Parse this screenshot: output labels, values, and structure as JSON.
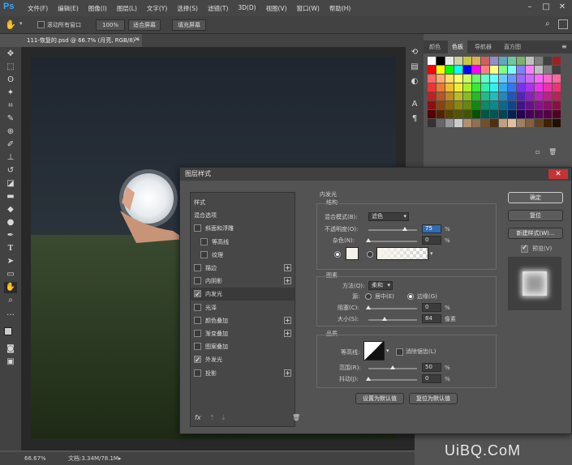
{
  "app": {
    "logo": "Ps"
  },
  "menu": [
    "文件(F)",
    "编辑(E)",
    "图像(I)",
    "图层(L)",
    "文字(Y)",
    "选择(S)",
    "滤镜(T)",
    "3D(D)",
    "视图(V)",
    "窗口(W)",
    "帮助(H)"
  ],
  "options_bar": {
    "scroll_all_label": "滚动所有窗口",
    "zoom_value": "100%",
    "fit_screen": "适合屏幕",
    "fill_screen": "填充屏幕"
  },
  "document": {
    "tab_label": "111-恢复的.psd @ 66.7% (月亮, RGB/8) *",
    "zoom": "66.67%",
    "doc_size": "文档:3.34M/78.1M"
  },
  "panels": {
    "tabs": [
      "颜色",
      "色板",
      "导航器",
      "直方图"
    ],
    "active_tab": "色板"
  },
  "swatches": {
    "rows": [
      [
        "#ffffff",
        "#000000",
        "#e8e8e8",
        "#d0d0a0",
        "#c8c840",
        "#e0b050",
        "#d06060",
        "#9090c8",
        "#60a8c0",
        "#70c8a0",
        "#80b070",
        "#c0c0c0",
        "#808080",
        "#404040",
        "#a02020"
      ],
      [
        "#ff0000",
        "#ffff00",
        "#00ff00",
        "#00ffff",
        "#0000ff",
        "#ff00ff",
        "#ff8080",
        "#ffff80",
        "#80ff80",
        "#80ffff",
        "#8080ff",
        "#ff80ff",
        "#c0c0c0",
        "#808080",
        "#404040"
      ],
      [
        "#ff6666",
        "#ffaa66",
        "#ffdd66",
        "#ffff66",
        "#ccff66",
        "#66ff66",
        "#66ffcc",
        "#66ffff",
        "#66ccff",
        "#6699ff",
        "#9966ff",
        "#cc66ff",
        "#ff66ff",
        "#ff66cc",
        "#ff6699"
      ],
      [
        "#ee3333",
        "#ee7733",
        "#eebb33",
        "#eeee33",
        "#aaee33",
        "#33ee33",
        "#33eeaa",
        "#33eeee",
        "#33aaee",
        "#3377ee",
        "#7733ee",
        "#aa33ee",
        "#ee33ee",
        "#ee33aa",
        "#ee3377"
      ],
      [
        "#bb2222",
        "#bb5522",
        "#bb8822",
        "#bbbb22",
        "#88bb22",
        "#22bb22",
        "#22bb88",
        "#22bbbb",
        "#2288bb",
        "#2255bb",
        "#5522bb",
        "#8822bb",
        "#bb22bb",
        "#bb2288",
        "#bb2255"
      ],
      [
        "#881111",
        "#884411",
        "#886611",
        "#888811",
        "#668811",
        "#118811",
        "#118866",
        "#118888",
        "#116688",
        "#114488",
        "#441188",
        "#661188",
        "#881188",
        "#881166",
        "#881144"
      ],
      [
        "#550000",
        "#552200",
        "#554400",
        "#555500",
        "#445500",
        "#005500",
        "#005544",
        "#005555",
        "#004455",
        "#002255",
        "#220055",
        "#440055",
        "#550055",
        "#550044",
        "#550022"
      ],
      [
        "#333333",
        "#666666",
        "#999999",
        "#cccccc",
        "#b09070",
        "#907050",
        "#705030",
        "#503010",
        "#c0a080",
        "#e0c0a0",
        "#a08060",
        "#806040",
        "#604020",
        "#402000",
        "#201000"
      ]
    ]
  },
  "dialog": {
    "title": "图层样式",
    "styles": [
      {
        "label": "样式",
        "check": false,
        "checked": false,
        "plus": false,
        "indent": false
      },
      {
        "label": "混合选项",
        "check": false,
        "checked": false,
        "plus": false,
        "indent": false
      },
      {
        "label": "斜面和浮雕",
        "check": true,
        "checked": false,
        "plus": false,
        "indent": false
      },
      {
        "label": "等高线",
        "check": true,
        "checked": false,
        "plus": false,
        "indent": true
      },
      {
        "label": "纹理",
        "check": true,
        "checked": false,
        "plus": false,
        "indent": true
      },
      {
        "label": "描边",
        "check": true,
        "checked": false,
        "plus": true,
        "indent": false
      },
      {
        "label": "内阴影",
        "check": true,
        "checked": false,
        "plus": true,
        "indent": false
      },
      {
        "label": "内发光",
        "check": true,
        "checked": true,
        "plus": false,
        "indent": false
      },
      {
        "label": "光泽",
        "check": true,
        "checked": false,
        "plus": false,
        "indent": false
      },
      {
        "label": "颜色叠加",
        "check": true,
        "checked": false,
        "plus": true,
        "indent": false
      },
      {
        "label": "渐变叠加",
        "check": true,
        "checked": false,
        "plus": true,
        "indent": false
      },
      {
        "label": "图案叠加",
        "check": true,
        "checked": false,
        "plus": false,
        "indent": false
      },
      {
        "label": "外发光",
        "check": true,
        "checked": true,
        "plus": false,
        "indent": false
      },
      {
        "label": "投影",
        "check": true,
        "checked": false,
        "plus": true,
        "indent": false
      }
    ],
    "selected_style": "内发光",
    "list_footer": {
      "fx": "fx",
      "up": "⇡",
      "down": "⇣",
      "trash": "🗑"
    },
    "section_title": "内发光",
    "structure": {
      "title": "结构",
      "blend_mode_label": "混合模式(B):",
      "blend_mode_value": "滤色",
      "opacity_label": "不透明度(O):",
      "opacity_value": "75",
      "opacity_unit": "%",
      "opacity_level": 0.75,
      "noise_label": "杂色(N):",
      "noise_value": "0",
      "noise_unit": "%",
      "noise_level": 0
    },
    "elements": {
      "title": "图素",
      "method_label": "方法(Q):",
      "method_value": "柔和",
      "source_label": "源:",
      "center_label": "居中(E)",
      "edge_label": "边缘(G)",
      "choke_label": "阻塞(C):",
      "choke_value": "0",
      "choke_unit": "%",
      "choke_level": 0,
      "size_label": "大小(S):",
      "size_value": "84",
      "size_unit": "像素",
      "size_level": 0.34
    },
    "quality": {
      "title": "品质",
      "contour_label": "等高线:",
      "antialias_label": "消除锯齿(L)",
      "range_label": "范围(R):",
      "range_value": "50",
      "range_unit": "%",
      "range_level": 0.5,
      "jitter_label": "抖动(J):",
      "jitter_value": "0",
      "jitter_unit": "%",
      "jitter_level": 0
    },
    "make_default": "设置为默认值",
    "reset_default": "复位为默认值",
    "buttons": {
      "ok": "确定",
      "reset": "复位",
      "new_style": "新建样式(W)...",
      "preview": "预览(V)"
    }
  },
  "watermark": "UiBQ.CoM"
}
